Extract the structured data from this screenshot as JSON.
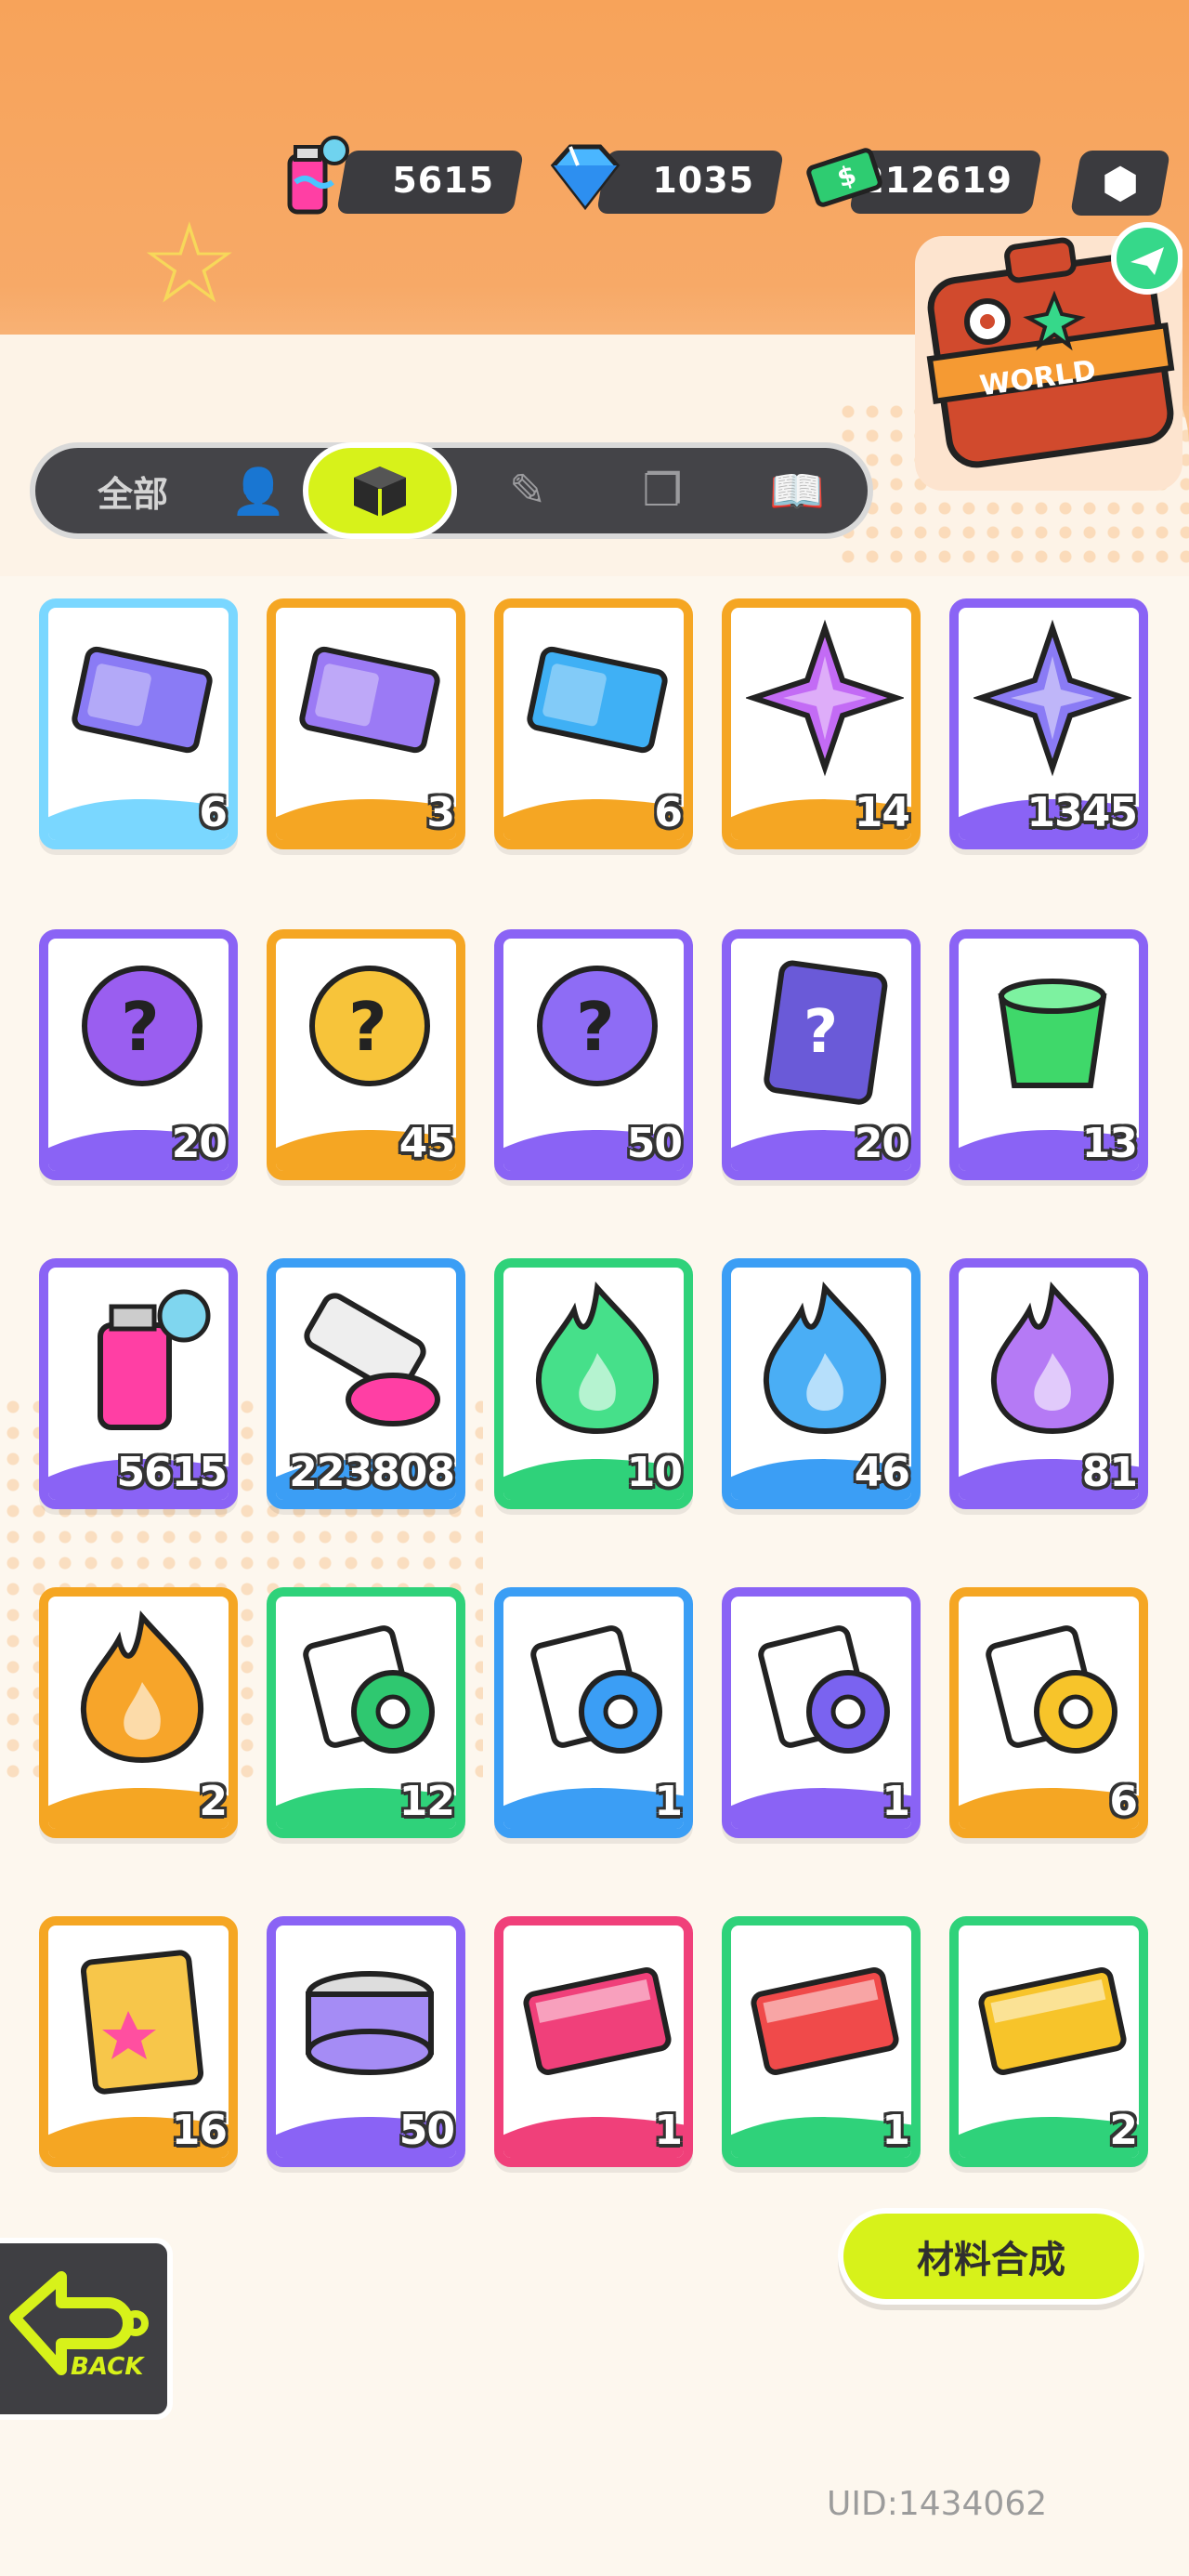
{
  "currencies": [
    {
      "icon": "spray-can-icon",
      "value": "5615"
    },
    {
      "icon": "diamond-icon",
      "value": "1035"
    },
    {
      "icon": "cash-icon",
      "value": "212619"
    }
  ],
  "world_badge": {
    "label": "WORLD"
  },
  "tabs": {
    "all_label": "全部"
  },
  "items": [
    {
      "icon": "rainbow-ticket-icon",
      "count": "6",
      "border": "#7ad7ff"
    },
    {
      "icon": "purple-ticket-icon",
      "count": "3",
      "border": "#f5a623"
    },
    {
      "icon": "tianyi-ticket-icon",
      "count": "6",
      "border": "#f5a623"
    },
    {
      "icon": "rainbow-star-icon",
      "count": "14",
      "border": "#f5a623"
    },
    {
      "icon": "purple-star-icon",
      "count": "1345",
      "border": "#8a63f5"
    },
    {
      "icon": "mystery-egg-icon",
      "count": "20",
      "border": "#8a63f5"
    },
    {
      "icon": "gold-mystery-coin-icon",
      "count": "45",
      "border": "#f5a623"
    },
    {
      "icon": "purple-mystery-coin-icon",
      "count": "50",
      "border": "#8a63f5"
    },
    {
      "icon": "mystery-travel-card-icon",
      "count": "20",
      "border": "#8a63f5"
    },
    {
      "icon": "green-jelly-cup-icon",
      "count": "13",
      "border": "#8a63f5"
    },
    {
      "icon": "spray-can-icon",
      "count": "5615",
      "border": "#8a63f5"
    },
    {
      "icon": "paint-tube-icon",
      "count": "223808",
      "border": "#3b9ef5"
    },
    {
      "icon": "green-flame-icon",
      "count": "10",
      "border": "#2fd27a"
    },
    {
      "icon": "blue-flame-icon",
      "count": "46",
      "border": "#3b9ef5"
    },
    {
      "icon": "purple-flame-icon",
      "count": "81",
      "border": "#8a63f5"
    },
    {
      "icon": "orange-flame-icon",
      "count": "2",
      "border": "#f5a623"
    },
    {
      "icon": "green-film-roll-icon",
      "count": "12",
      "border": "#2fd27a"
    },
    {
      "icon": "blue-film-roll-icon",
      "count": "1",
      "border": "#3b9ef5"
    },
    {
      "icon": "purple-film-roll-icon",
      "count": "1",
      "border": "#8a63f5"
    },
    {
      "icon": "gold-film-roll-icon",
      "count": "6",
      "border": "#f5a623"
    },
    {
      "icon": "sticker-pack-icon",
      "count": "16",
      "border": "#f5a623"
    },
    {
      "icon": "cool-can-icon",
      "count": "50",
      "border": "#8a63f5"
    },
    {
      "icon": "pink-card-icon",
      "count": "1",
      "border": "#f0407a"
    },
    {
      "icon": "red-coupon-icon",
      "count": "1",
      "border": "#2fd27a"
    },
    {
      "icon": "gold-coupon-icon",
      "count": "2",
      "border": "#2fd27a"
    }
  ],
  "synth_button": "材料合成",
  "back_label": "BACK",
  "uid": "UID:1434062",
  "colors": {
    "accent": "#d7f21a",
    "header_orange": "#f7a35a",
    "dark": "#3b3b3f"
  }
}
